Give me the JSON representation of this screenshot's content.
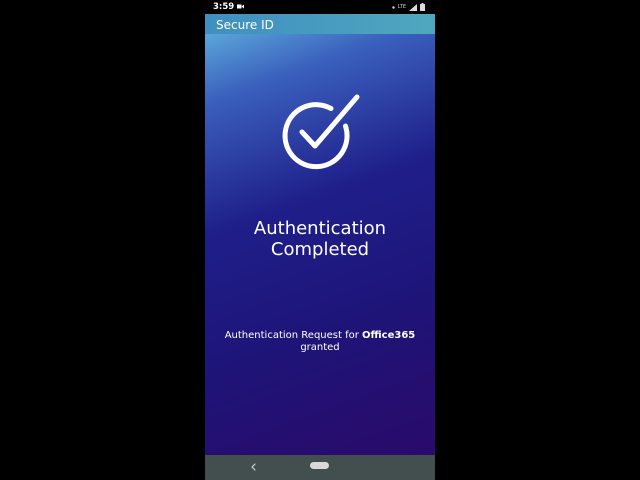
{
  "status_bar": {
    "time": "3:59",
    "icons": [
      "video-icon",
      "dot-icon",
      "signal-icon",
      "battery-icon"
    ],
    "network_label": "LTE"
  },
  "app": {
    "title": "Secure ID",
    "header_color": "#4a9fc0"
  },
  "auth": {
    "icon": "check-circle-icon",
    "title": "Authentication\nCompleted",
    "message_prefix": "Authentication Request for ",
    "app_name": "Office365",
    "message_suffix": "granted"
  },
  "navigation": {
    "back_icon": "back-chevron-icon",
    "home_icon": "home-pill-icon"
  },
  "colors": {
    "gradient_top": "#5aa6d9",
    "gradient_bottom": "#2a0a6a",
    "nav_bar": "#434f4f"
  }
}
